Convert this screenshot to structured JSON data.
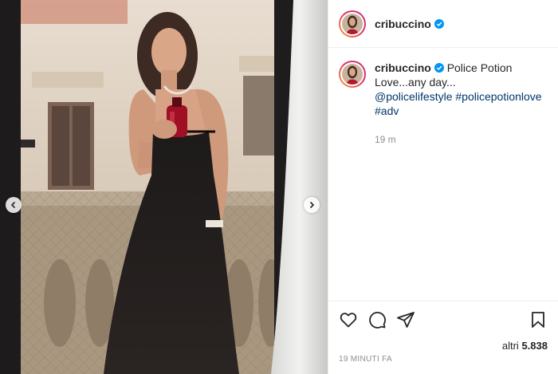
{
  "post": {
    "username": "cribuccino",
    "verified": true,
    "caption": "Police Potion Love...any day...",
    "mentions": [
      "@policelifestyle",
      "#policepotionlove",
      "#adv"
    ],
    "time_short": "19 m",
    "likes_prefix": "altri",
    "likes_count": "5.838",
    "timestamp": "19 MINUTI FA"
  },
  "icons": {
    "like": "heart-icon",
    "comment": "comment-icon",
    "share": "share-icon",
    "save": "bookmark-icon",
    "prev": "chevron-left-icon",
    "next": "chevron-right-icon",
    "verified": "verified-badge-icon"
  },
  "colors": {
    "verified_blue": "#0095f6",
    "link": "#00376b",
    "muted": "#8e8e8e",
    "text": "#262626"
  }
}
